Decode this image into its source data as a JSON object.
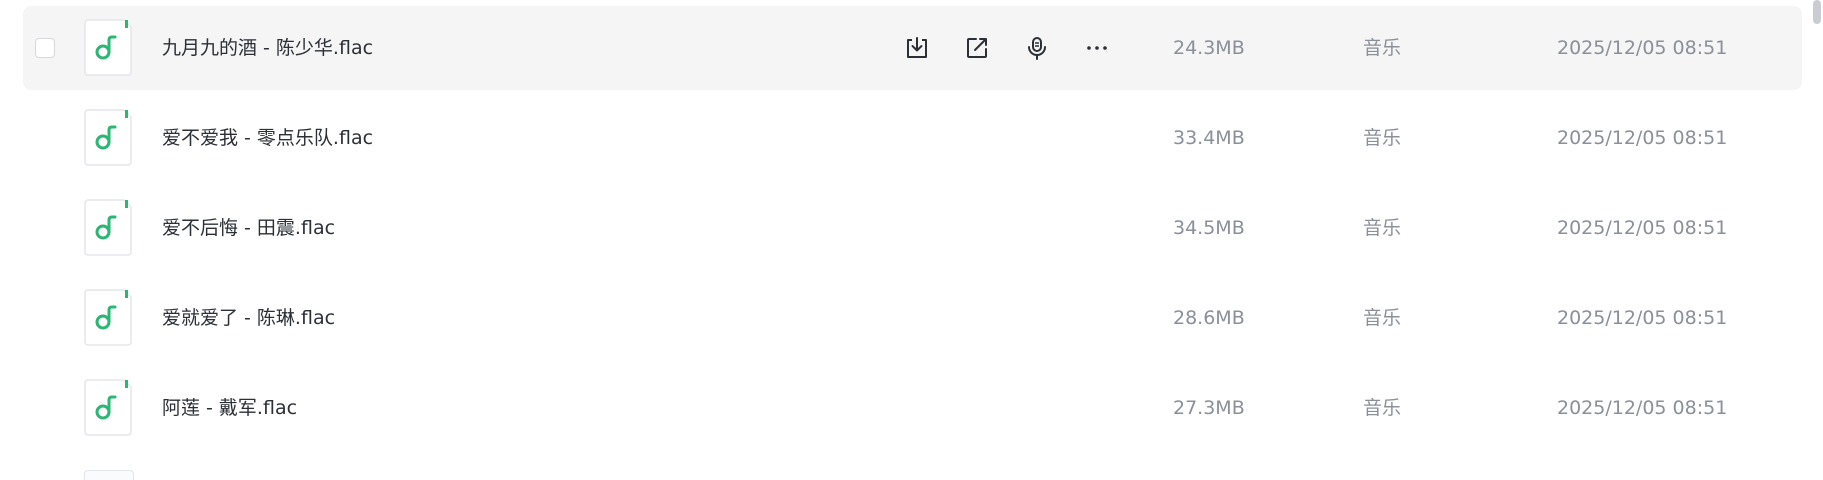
{
  "files": [
    {
      "name": "九月九的酒 - 陈少华.flac",
      "size": "24.3MB",
      "type": "音乐",
      "date": "2025/12/05 08:51"
    },
    {
      "name": "爱不爱我 - 零点乐队.flac",
      "size": "33.4MB",
      "type": "音乐",
      "date": "2025/12/05 08:51"
    },
    {
      "name": "爱不后悔 - 田震.flac",
      "size": "34.5MB",
      "type": "音乐",
      "date": "2025/12/05 08:51"
    },
    {
      "name": "爱就爱了 - 陈琳.flac",
      "size": "28.6MB",
      "type": "音乐",
      "date": "2025/12/05 08:51"
    },
    {
      "name": "阿莲 - 戴军.flac",
      "size": "27.3MB",
      "type": "音乐",
      "date": "2025/12/05 08:51"
    }
  ],
  "icons": {
    "file": "music-file-icon",
    "download": "download-icon",
    "share": "share-icon",
    "listen": "microphone-icon",
    "more": "more-icon"
  },
  "colors": {
    "accent": "#2bb673",
    "selected_row": "#f5f5f6",
    "primary_text": "#2b2f36",
    "secondary_text": "#8a8f99"
  }
}
